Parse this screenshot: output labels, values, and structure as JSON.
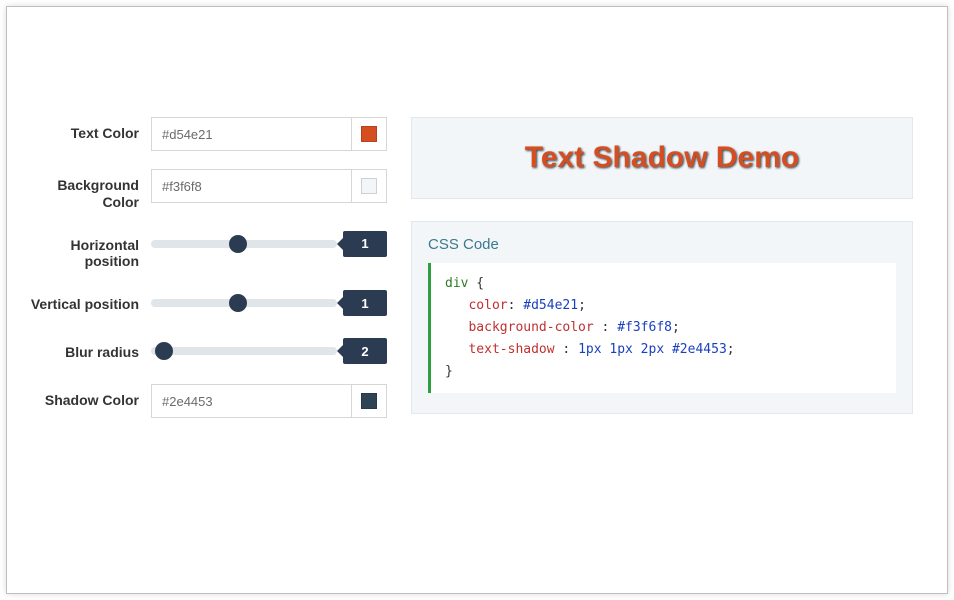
{
  "controls": {
    "textColor": {
      "label": "Text Color",
      "value": "#d54e21"
    },
    "bgColor": {
      "label": "Background Color",
      "value": "#f3f6f8"
    },
    "hPos": {
      "label": "Horizontal position",
      "value": "1",
      "pct": 47
    },
    "vPos": {
      "label": "Vertical position",
      "value": "1",
      "pct": 47
    },
    "blur": {
      "label": "Blur radius",
      "value": "2",
      "pct": 7
    },
    "shadowColor": {
      "label": "Shadow Color",
      "value": "#2e4453"
    }
  },
  "demo": {
    "text": "Text Shadow Demo"
  },
  "code": {
    "title": "CSS Code",
    "selector": "div",
    "lines": [
      {
        "prop": "color",
        "val": "#d54e21"
      },
      {
        "prop": "background-color",
        "val": "#f3f6f8"
      },
      {
        "prop": "text-shadow",
        "val": "1px 1px 2px #2e4453"
      }
    ]
  },
  "colors": {
    "textColorSwatch": "#d54e21",
    "bgColorSwatch": "#f3f6f8",
    "shadowColorSwatch": "#2e4453"
  }
}
